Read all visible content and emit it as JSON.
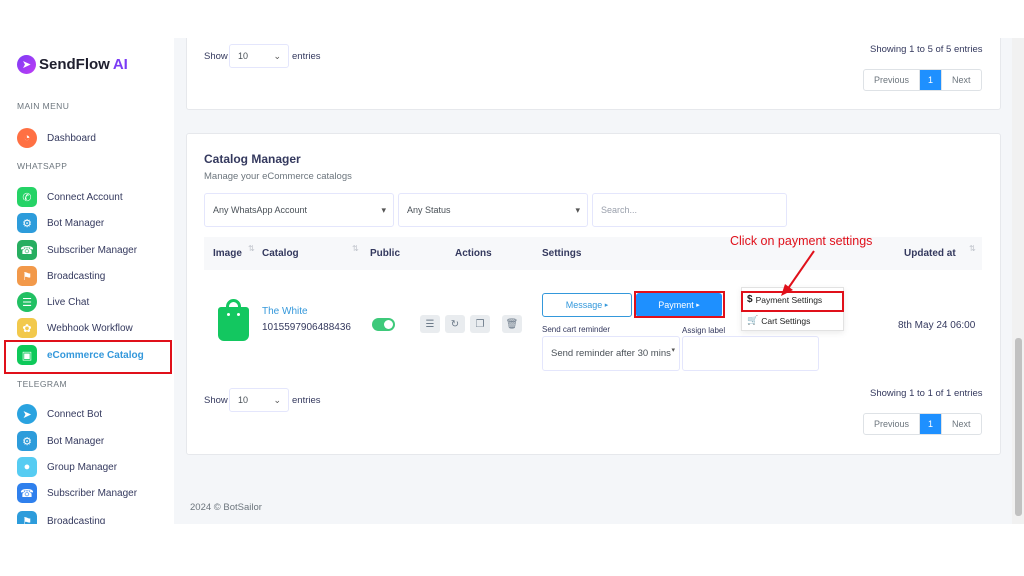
{
  "brand": {
    "name": "SendFlow",
    "suffix": "AI"
  },
  "sidebar": {
    "main_menu_title": "MAIN MENU",
    "whatsapp_title": "WHATSAPP",
    "telegram_title": "TELEGRAM",
    "main_items": [
      {
        "label": "Dashboard",
        "icon": "dashboard-icon"
      }
    ],
    "whatsapp_items": [
      {
        "label": "Connect Account",
        "icon": "whatsapp-icon"
      },
      {
        "label": "Bot Manager",
        "icon": "bot-icon"
      },
      {
        "label": "Subscriber Manager",
        "icon": "subscriber-icon"
      },
      {
        "label": "Broadcasting",
        "icon": "broadcast-icon"
      },
      {
        "label": "Live Chat",
        "icon": "chat-icon"
      },
      {
        "label": "Webhook Workflow",
        "icon": "webhook-icon"
      },
      {
        "label": "eCommerce Catalog",
        "icon": "shopping-bag-icon",
        "active": true
      }
    ],
    "telegram_items": [
      {
        "label": "Connect Bot",
        "icon": "telegram-icon"
      },
      {
        "label": "Bot Manager",
        "icon": "bot-icon"
      },
      {
        "label": "Group Manager",
        "icon": "group-icon"
      },
      {
        "label": "Subscriber Manager",
        "icon": "subscriber-icon"
      },
      {
        "label": "Broadcasting",
        "icon": "broadcast-icon"
      }
    ]
  },
  "top_card": {
    "show_label": "Show",
    "entries_value": "10",
    "entries_label": "entries",
    "showing_text": "Showing 1 to 5 of 5 entries",
    "pager": {
      "previous": "Previous",
      "current": "1",
      "next": "Next"
    }
  },
  "catalog": {
    "title": "Catalog Manager",
    "subtitle": "Manage your eCommerce catalogs",
    "filters": {
      "account": "Any WhatsApp Account",
      "status": "Any Status",
      "search_placeholder": "Search..."
    },
    "columns": {
      "image": "Image",
      "catalog": "Catalog",
      "public": "Public",
      "actions": "Actions",
      "settings": "Settings",
      "updated": "Updated at"
    },
    "row": {
      "name": "The White",
      "id": "1015597906488436",
      "public": true,
      "message_btn": "Message",
      "payment_btn": "Payment",
      "cart_reminder_label": "Send cart reminder",
      "cart_reminder_value": "Send reminder after 30 mins",
      "assign_label": "Assign label",
      "updated_at": "8th May 24 06:00"
    },
    "payment_menu": {
      "payment_settings": "Payment Settings",
      "cart_settings": "Cart Settings"
    },
    "show_label": "Show",
    "entries_value": "10",
    "entries_label": "entries",
    "showing_text": "Showing 1 to 1 of 1 entries",
    "pager": {
      "previous": "Previous",
      "current": "1",
      "next": "Next"
    }
  },
  "annotation": "Click on payment settings",
  "footer": "2024 © BotSailor",
  "colors": {
    "accent": "#1e90ff",
    "highlight": "#e0101a",
    "toggle": "#3ec97a",
    "link": "#3498db"
  }
}
